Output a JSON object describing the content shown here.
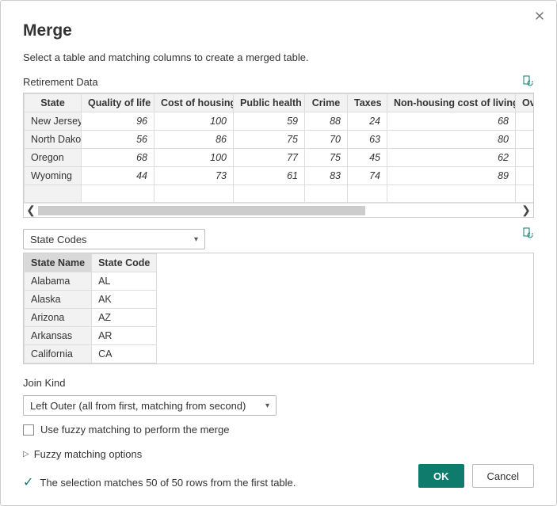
{
  "title": "Merge",
  "subtitle": "Select a table and matching columns to create a merged table.",
  "table1": {
    "label": "Retirement Data",
    "columns": [
      "State",
      "Quality of life",
      "Cost of housing",
      "Public health",
      "Crime",
      "Taxes",
      "Non-housing cost of living",
      "Ov"
    ],
    "rows": [
      {
        "state": "New Jersey",
        "quality": 96,
        "housing": 100,
        "health": 59,
        "crime": 88,
        "taxes": 24,
        "nonhousing": 68
      },
      {
        "state": "North Dakota",
        "quality": 56,
        "housing": 86,
        "health": 75,
        "crime": 70,
        "taxes": 63,
        "nonhousing": 80
      },
      {
        "state": "Oregon",
        "quality": 68,
        "housing": 100,
        "health": 77,
        "crime": 75,
        "taxes": 45,
        "nonhousing": 62
      },
      {
        "state": "Wyoming",
        "quality": 44,
        "housing": 73,
        "health": 61,
        "crime": 83,
        "taxes": 74,
        "nonhousing": 89
      }
    ]
  },
  "table2": {
    "dropdown_value": "State Codes",
    "columns": [
      "State Name",
      "State Code"
    ],
    "rows": [
      {
        "name": "Alabama",
        "code": "AL"
      },
      {
        "name": "Alaska",
        "code": "AK"
      },
      {
        "name": "Arizona",
        "code": "AZ"
      },
      {
        "name": "Arkansas",
        "code": "AR"
      },
      {
        "name": "California",
        "code": "CA"
      }
    ]
  },
  "join": {
    "label": "Join Kind",
    "value": "Left Outer (all from first, matching from second)"
  },
  "fuzzy_checkbox_label": "Use fuzzy matching to perform the merge",
  "fuzzy_expander_label": "Fuzzy matching options",
  "status_text": "The selection matches 50 of 50 rows from the first table.",
  "buttons": {
    "ok": "OK",
    "cancel": "Cancel"
  }
}
